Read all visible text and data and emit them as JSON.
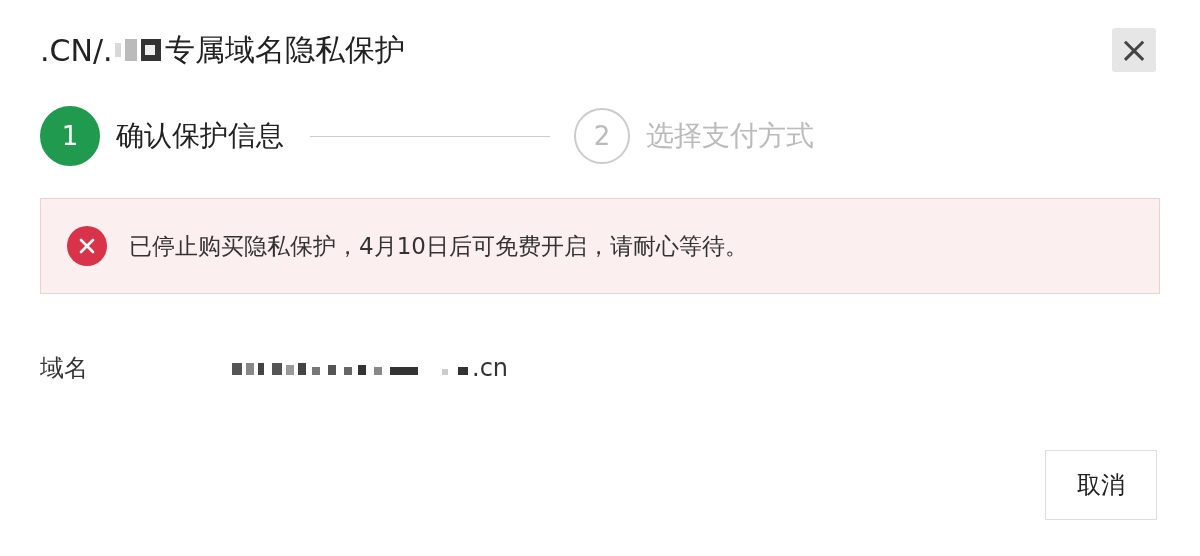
{
  "dialog": {
    "title_prefix": ".CN/.",
    "title_suffix": "专属域名隐私保护",
    "close": "×"
  },
  "steps": [
    {
      "number": "1",
      "label": "确认保护信息",
      "selected": true
    },
    {
      "number": "2",
      "label": "选择支付方式",
      "selected": false
    }
  ],
  "alert": {
    "kind": "error",
    "message": "已停止购买隐私保护，4月10日后可免费开启，请耐心等待。"
  },
  "fields": [
    {
      "label": "域名",
      "value_suffix": ".cn"
    }
  ],
  "buttons": [
    "取消"
  ]
}
